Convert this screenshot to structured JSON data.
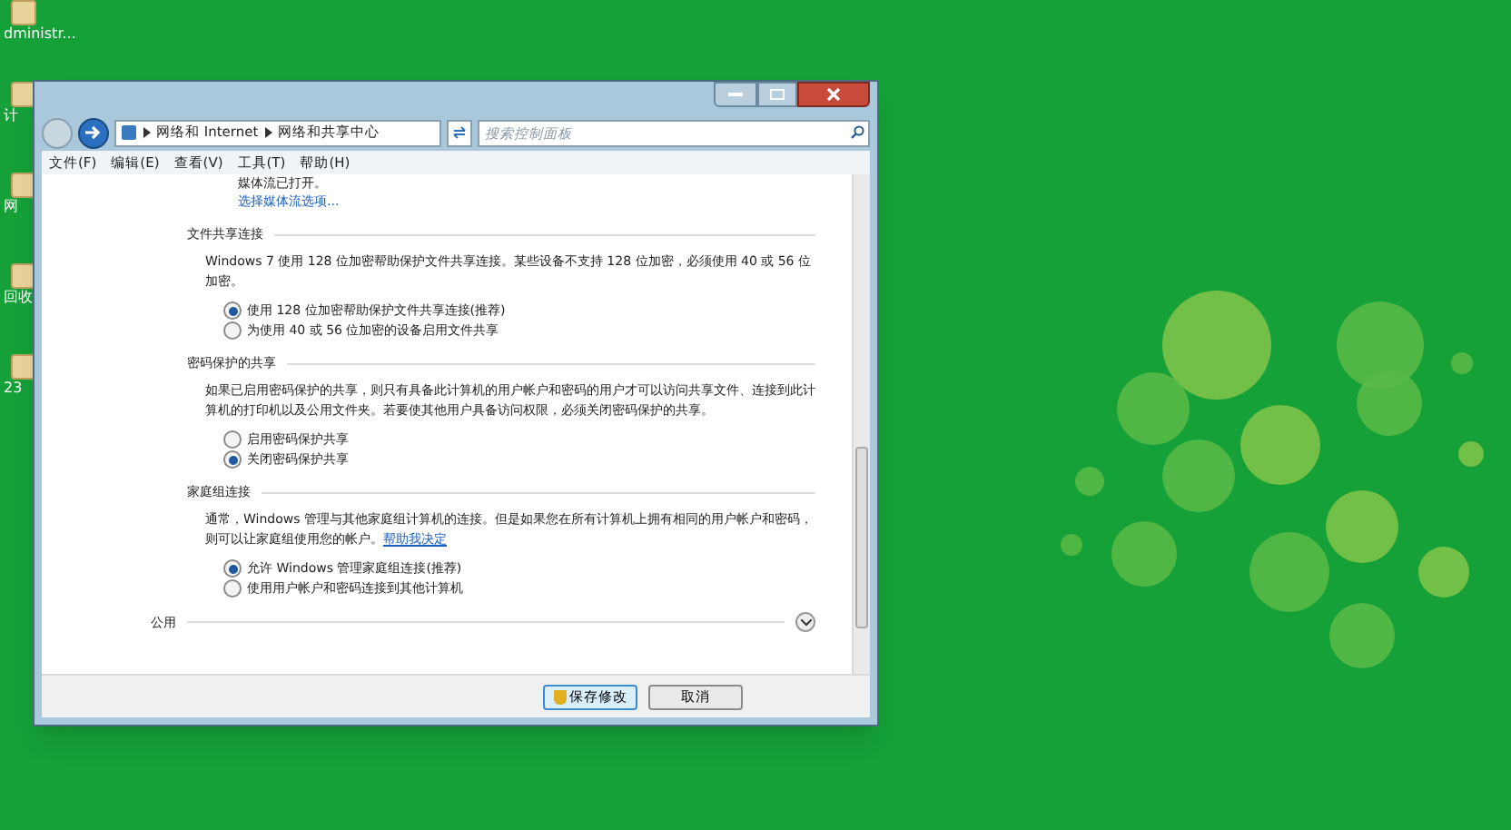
{
  "desktop_icons": [
    {
      "label": "dministr..."
    },
    {
      "label": "计"
    },
    {
      "label": "网"
    },
    {
      "label": "回收"
    },
    {
      "label": "23"
    }
  ],
  "window": {
    "breadcrumb": [
      "网络和 Internet",
      "网络和共享中心"
    ],
    "search": {
      "placeholder": "搜索控制面板"
    },
    "menu": [
      "文件(F)",
      "编辑(E)",
      "查看(V)",
      "工具(T)",
      "帮助(H)"
    ],
    "top_text": "媒体流已打开。",
    "top_link": "选择媒体流选项...",
    "sections": [
      {
        "title": "文件共享连接",
        "text": "Windows 7 使用 128 位加密帮助保护文件共享连接。某些设备不支持 128 位加密，必须使用 40 或 56 位加密。",
        "options": [
          {
            "label": "使用 128 位加密帮助保护文件共享连接(推荐)",
            "selected": true
          },
          {
            "label": "为使用 40 或 56 位加密的设备启用文件共享",
            "selected": false
          }
        ]
      },
      {
        "title": "密码保护的共享",
        "text": "如果已启用密码保护的共享，则只有具备此计算机的用户帐户和密码的用户才可以访问共享文件、连接到此计算机的打印机以及公用文件夹。若要使其他用户具备访问权限，必须关闭密码保护的共享。",
        "options": [
          {
            "label": "启用密码保护共享",
            "selected": false
          },
          {
            "label": "关闭密码保护共享",
            "selected": true
          }
        ]
      },
      {
        "title": "家庭组连接",
        "text": "通常，Windows 管理与其他家庭组计算机的连接。但是如果您在所有计算机上拥有相同的用户帐户和密码，则可以让家庭组使用您的帐户。",
        "link": "帮助我决定",
        "options": [
          {
            "label": "允许 Windows 管理家庭组连接(推荐)",
            "selected": true
          },
          {
            "label": "使用用户帐户和密码连接到其他计算机",
            "selected": false
          }
        ]
      }
    ],
    "collapsed_section": {
      "title": "公用",
      "expanded": false
    },
    "buttons": [
      {
        "label": "保存修改",
        "kind": "primary"
      },
      {
        "label": "取消",
        "kind": "normal"
      }
    ]
  }
}
